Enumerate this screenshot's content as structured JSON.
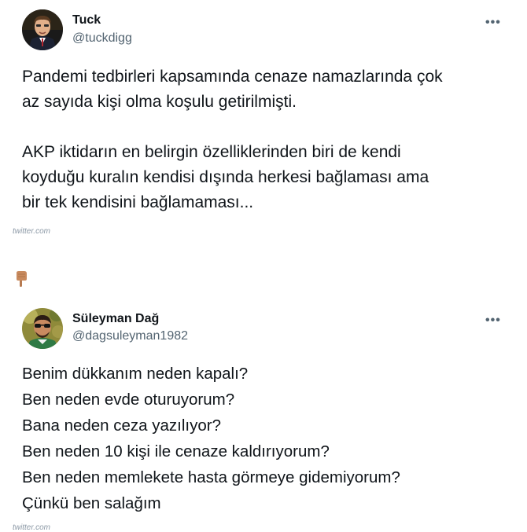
{
  "tweets": [
    {
      "author_name": "Tuck",
      "author_handle": "@tuckdigg",
      "more_label": "•••",
      "lines": [
        "Pandemi tedbirleri kapsamında cenaze namazlarında çok",
        "az sayıda kişi olma koşulu getirilmişti.",
        "AKP iktidarın en belirgin özelliklerinden biri de kendi",
        "koyduğu kuralın kendisi dışında herkesi bağlaması ama",
        "bir tek kendisini bağlamaması..."
      ],
      "source": "twitter.com"
    },
    {
      "author_name": "Süleyman Dağ",
      "author_handle": "@dagsuleyman1982",
      "more_label": "•••",
      "lines": [
        "Benim dükkanım neden kapalı?",
        "Ben neden evde oturuyorum?",
        "Bana neden ceza yazılıyor?",
        "Ben neden 10 kişi ile cenaze kaldırıyorum?",
        "Ben neden memlekete hasta görmeye gidemiyorum?",
        "Çünkü ben salağım"
      ],
      "source": "twitter.com"
    }
  ],
  "pointer_icon": "backhand-index-pointing-down-icon"
}
